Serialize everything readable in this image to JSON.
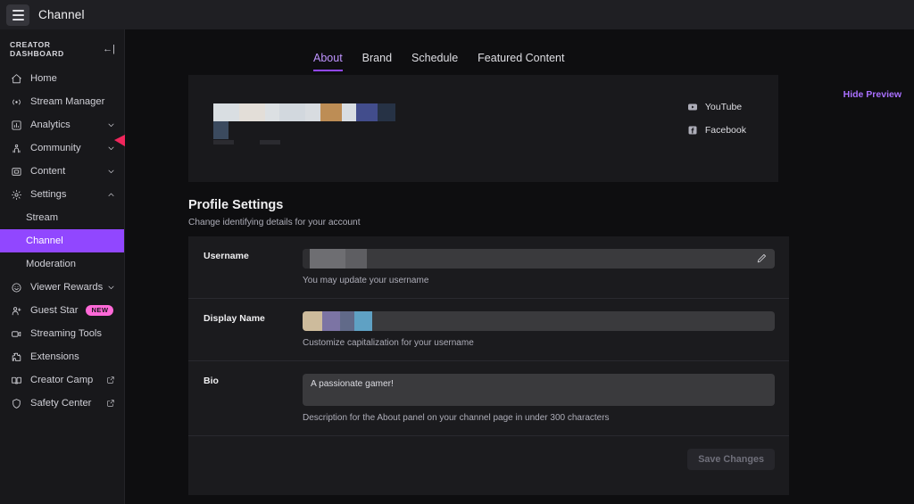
{
  "topbar": {
    "title": "Channel",
    "menu_icon": "hamburger-icon"
  },
  "sidebar": {
    "header": {
      "label": "CREATOR DASHBOARD",
      "collapse_icon": "collapse-left-icon"
    },
    "items": [
      {
        "label": "Home",
        "icon": "home-icon",
        "type": "link"
      },
      {
        "label": "Stream Manager",
        "icon": "broadcast-icon",
        "type": "link"
      },
      {
        "label": "Analytics",
        "icon": "chart-icon",
        "type": "expandable",
        "chevron": "chevron-down-icon"
      },
      {
        "label": "Community",
        "icon": "community-icon",
        "type": "expandable",
        "chevron": "chevron-down-icon"
      },
      {
        "label": "Content",
        "icon": "content-icon",
        "type": "expandable",
        "chevron": "chevron-down-icon"
      },
      {
        "label": "Settings",
        "icon": "gear-icon",
        "type": "expandable",
        "chevron": "chevron-up-icon"
      },
      {
        "label": "Stream",
        "type": "sub"
      },
      {
        "label": "Channel",
        "type": "sub",
        "active": true
      },
      {
        "label": "Moderation",
        "type": "sub"
      },
      {
        "label": "Viewer Rewards",
        "icon": "smiley-icon",
        "type": "expandable",
        "chevron": "chevron-down-icon"
      },
      {
        "label": "Guest Star",
        "icon": "user-plus-icon",
        "type": "link",
        "badge": "NEW"
      },
      {
        "label": "Streaming Tools",
        "icon": "video-camera-icon",
        "type": "link"
      },
      {
        "label": "Extensions",
        "icon": "puzzle-icon",
        "type": "link"
      },
      {
        "label": "Creator Camp",
        "icon": "book-icon",
        "type": "link",
        "external": "external-link-icon"
      },
      {
        "label": "Safety Center",
        "icon": "shield-icon",
        "type": "link",
        "external": "external-link-icon"
      }
    ]
  },
  "annotation": {
    "arrow_color": "#f0265c",
    "points_at": "Community"
  },
  "main": {
    "tabs": [
      {
        "label": "About",
        "active": true
      },
      {
        "label": "Brand",
        "active": false
      },
      {
        "label": "Schedule",
        "active": false
      },
      {
        "label": "Featured Content",
        "active": false
      }
    ],
    "hide_preview_label": "Hide Preview",
    "preview": {
      "redacted_blocks_row1": [
        "#d9dee2",
        "#e3ded8",
        "#dce0e3",
        "#d2d8de",
        "#d8dce0",
        "#bd8d55",
        "#d8dde2",
        "#424d8c",
        "#263245"
      ],
      "redacted_blocks_row2": [
        "#3b4a5e"
      ],
      "socials": [
        {
          "label": "YouTube",
          "icon": "youtube-icon"
        },
        {
          "label": "Facebook",
          "icon": "facebook-icon"
        }
      ]
    },
    "profile_settings": {
      "title": "Profile Settings",
      "subtitle": "Change identifying details for your account",
      "fields": [
        {
          "label": "Username",
          "value": "",
          "redacted_blocks": [
            "#2e2e31",
            "#6e6e72",
            "#5e5e62"
          ],
          "hint": "You may update your username",
          "edit_icon": "pencil-icon"
        },
        {
          "label": "Display Name",
          "value": "",
          "redacted_blocks": [
            "#cdbb9c",
            "#7c74a4",
            "#616a89",
            "#5fa1c4"
          ],
          "hint": "Customize capitalization for your username"
        },
        {
          "label": "Bio",
          "value": "A passionate gamer!",
          "hint": "Description for the About panel on your channel page in under 300 characters"
        }
      ],
      "save_label": "Save Changes",
      "save_disabled": true
    }
  },
  "colors": {
    "accent_purple": "#9147ff",
    "link_purple": "#a970ff",
    "badge_pink": "#ff69d8",
    "page_bg": "#0e0e10",
    "sidebar_bg": "#18181b"
  }
}
